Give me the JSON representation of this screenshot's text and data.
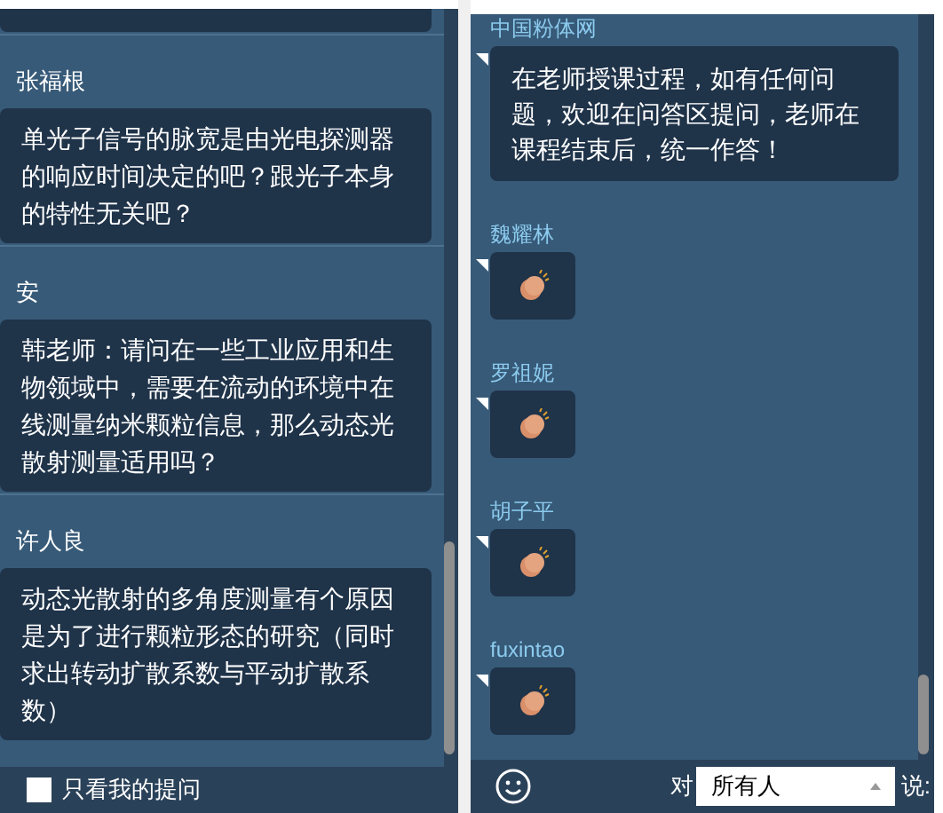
{
  "questions": [
    {
      "name": "张福根",
      "text": "单光子信号的脉宽是由光电探测器的响应时间决定的吧？跟光子本身的特性无关吧？"
    },
    {
      "name": "安",
      "text": "韩老师：请问在一些工业应用和生物领域中，需要在流动的环境中在线测量纳米颗粒信息，那么动态光散射测量适用吗？"
    },
    {
      "name": "许人良",
      "text": "动态光散射的多角度测量有个原因是为了进行颗粒形态的研究（同时求出转动扩散系数与平动扩散系数）"
    }
  ],
  "only_mine": {
    "label": "只看我的提问",
    "checked": false
  },
  "chat": [
    {
      "name": "中国粉体网",
      "kind": "text",
      "text": "在老师授课过程，如有任何问题，欢迎在问答区提问，老师在课程结束后，统一作答！"
    },
    {
      "name": "魏耀林",
      "kind": "clap"
    },
    {
      "name": "罗祖妮",
      "kind": "clap"
    },
    {
      "name": "胡子平",
      "kind": "clap"
    },
    {
      "name": "fuxintao",
      "kind": "clap"
    }
  ],
  "composer": {
    "to_label": "对",
    "recipient": "所有人",
    "say_label": "说:"
  }
}
